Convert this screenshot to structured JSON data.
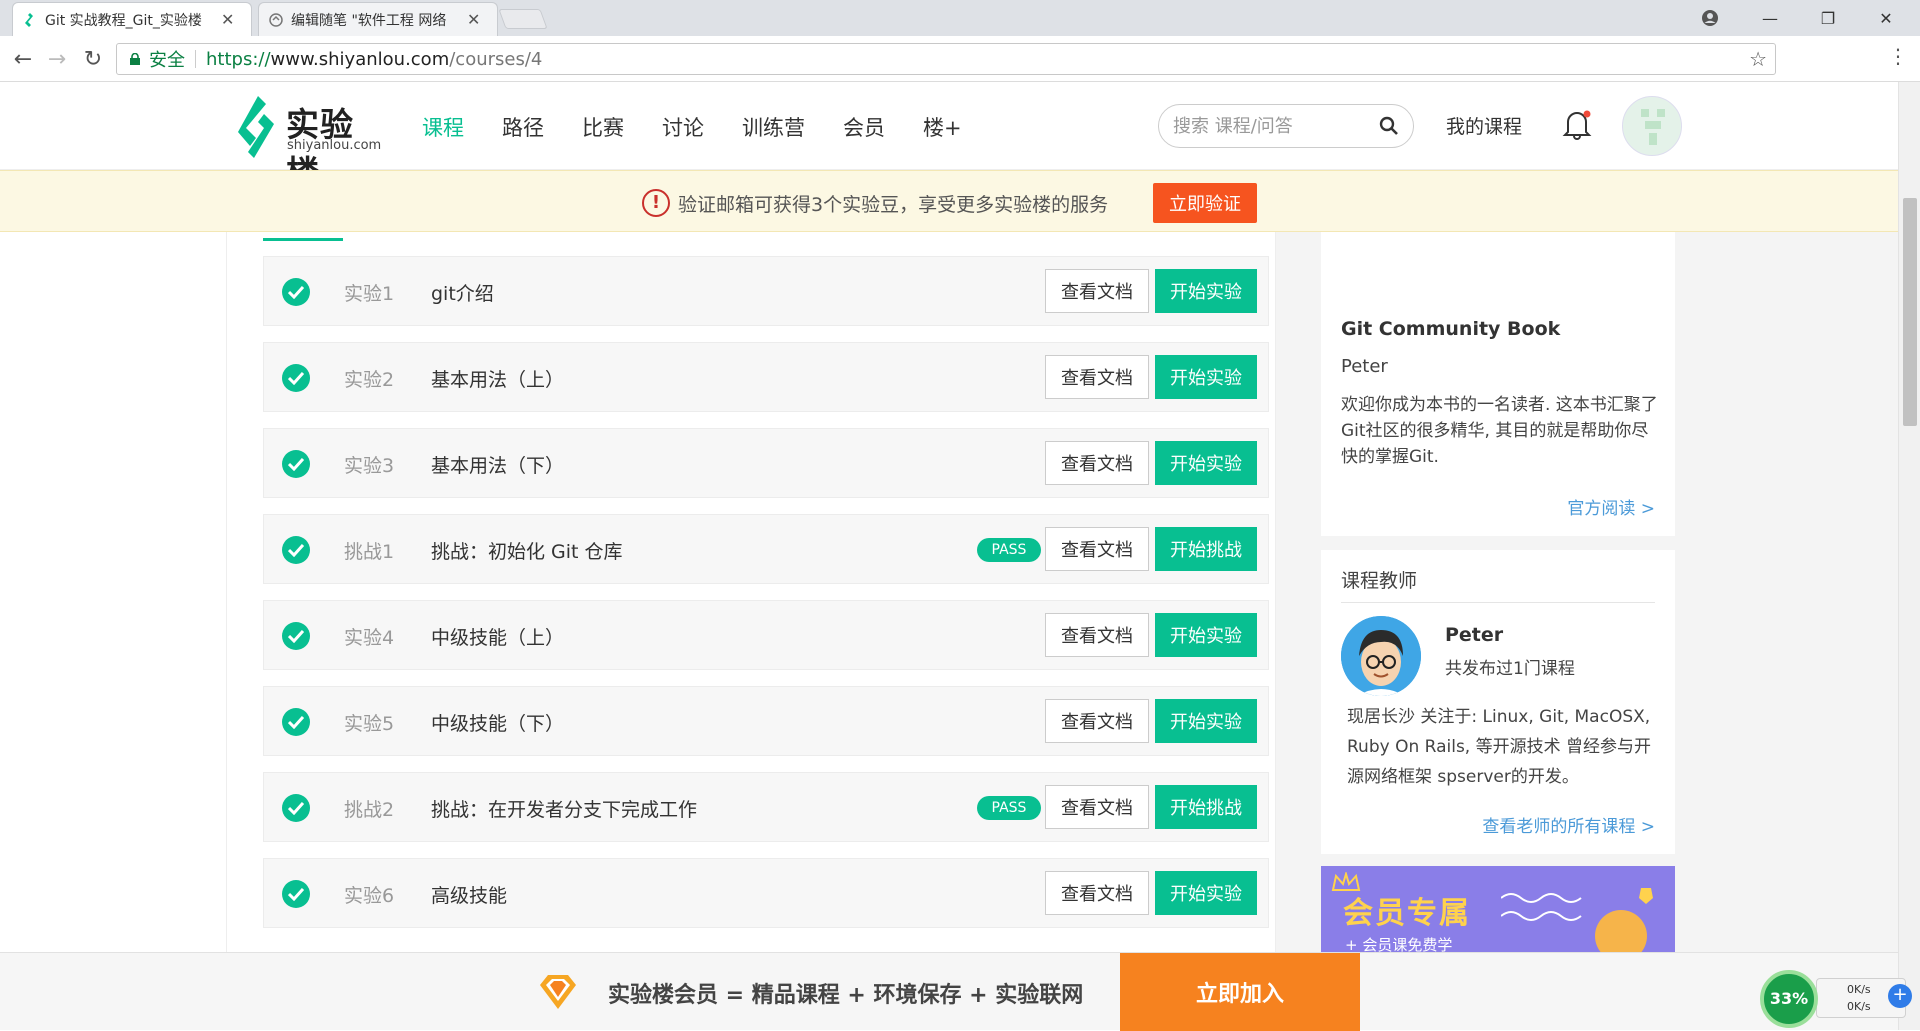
{
  "browser": {
    "tabs": [
      {
        "title": "Git 实战教程_Git_实验楼",
        "active": true
      },
      {
        "title": "编辑随笔 \"软件工程 网络",
        "active": false
      }
    ],
    "address": {
      "secure_label": "安全",
      "url_scheme": "https://",
      "url_host": "www.shiyanlou.com",
      "url_path": "/courses/4"
    }
  },
  "header": {
    "logo_cn": "实验楼",
    "logo_en": "shiyanlou.com",
    "nav": [
      "课程",
      "路径",
      "比赛",
      "讨论",
      "训练营",
      "会员",
      "楼+"
    ],
    "search_placeholder": "搜索 课程/问答",
    "my_courses": "我的课程"
  },
  "banner": {
    "text": "验证邮箱可获得3个实验豆，享受更多实验楼的服务",
    "button": "立即验证"
  },
  "labs": [
    {
      "num": "实验1",
      "title": "git介绍",
      "pass": false,
      "doc": "查看文档",
      "start": "开始实验"
    },
    {
      "num": "实验2",
      "title": "基本用法（上）",
      "pass": false,
      "doc": "查看文档",
      "start": "开始实验"
    },
    {
      "num": "实验3",
      "title": "基本用法（下）",
      "pass": false,
      "doc": "查看文档",
      "start": "开始实验"
    },
    {
      "num": "挑战1",
      "title": "挑战：初始化 Git 仓库",
      "pass": true,
      "pass_label": "PASS",
      "doc": "查看文档",
      "start": "开始挑战"
    },
    {
      "num": "实验4",
      "title": "中级技能（上）",
      "pass": false,
      "doc": "查看文档",
      "start": "开始实验"
    },
    {
      "num": "实验5",
      "title": "中级技能（下）",
      "pass": false,
      "doc": "查看文档",
      "start": "开始实验"
    },
    {
      "num": "挑战2",
      "title": "挑战：在开发者分支下完成工作",
      "pass": true,
      "pass_label": "PASS",
      "doc": "查看文档",
      "start": "开始挑战"
    },
    {
      "num": "实验6",
      "title": "高级技能",
      "pass": false,
      "doc": "查看文档",
      "start": "开始实验"
    }
  ],
  "book": {
    "title": "Git Community Book",
    "author": "Peter",
    "desc": "欢迎你成为本书的一名读者. 这本书汇聚了Git社区的很多精华, 其目的就是帮助你尽快的掌握Git.",
    "link": "官方阅读 >"
  },
  "teacher": {
    "heading": "课程教师",
    "name": "Peter",
    "count": "共发布过1门课程",
    "bio": "现居长沙 关注于: Linux, Git, MacOSX, Ruby On Rails, 等开源技术 曾经参与开源网络框架 spserver的开发。",
    "link": "查看老师的所有课程 >"
  },
  "vip_ad": {
    "text": "会员专属",
    "sub": "+ 会员课免费学"
  },
  "member_bar": {
    "text": "实验楼会员 = 精品课程 + 环境保存 + 实验联网",
    "button": "立即加入"
  },
  "speed_widget": {
    "percent": "33%",
    "up": "0K/s",
    "down": "0K/s"
  },
  "colors": {
    "brand_green": "#08bf91",
    "banner_orange": "#f6541f",
    "join_orange": "#f6821f",
    "link_blue": "#4b9ad8"
  }
}
